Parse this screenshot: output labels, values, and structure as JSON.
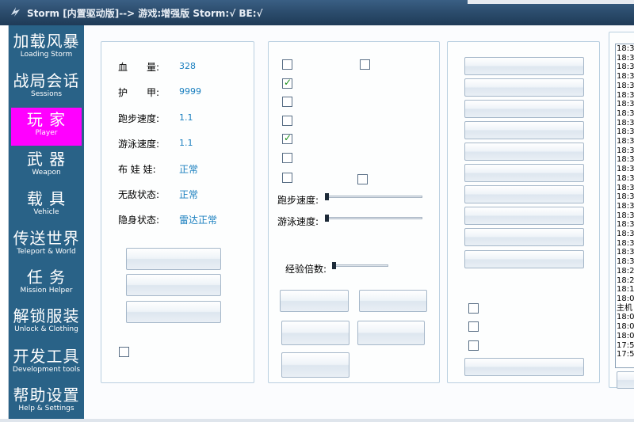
{
  "window": {
    "title": "Storm [内置驱动版]--> 游戏:增强版 Storm:√ BE:√"
  },
  "sidebar": {
    "items": [
      {
        "cn": "加载风暴",
        "en": "Loading Storm"
      },
      {
        "cn": "战局会话",
        "en": "Sessions"
      },
      {
        "cn": "玩 家",
        "en": "Player"
      },
      {
        "cn": "武 器",
        "en": "Weapon"
      },
      {
        "cn": "载 具",
        "en": "Vehicle"
      },
      {
        "cn": "传送世界",
        "en": "Teleport & World"
      },
      {
        "cn": "任 务",
        "en": "Mission Helper"
      },
      {
        "cn": "解锁服装",
        "en": "Unlock & Clothing"
      },
      {
        "cn": "开发工具",
        "en": "Development tools"
      },
      {
        "cn": "帮助设置",
        "en": "Help & Settings"
      }
    ],
    "active_index": 2,
    "active_color": "#ff00ff"
  },
  "player_stats": {
    "health_label": "血　　量:",
    "health_value": "328",
    "armor_label": "护　　甲:",
    "armor_value": "9999",
    "run_speed_label": "跑步速度:",
    "run_speed_value": "1.1",
    "swim_speed_label": "游泳速度:",
    "swim_speed_value": "1.1",
    "ragdoll_label": "布 娃 娃:",
    "ragdoll_value": "正常",
    "invincible_label": "无敌状态:",
    "invincible_value": "正常",
    "stealth_label": "隐身状态:",
    "stealth_value": "雷达正常"
  },
  "player_options": {
    "checkboxes_checked": [
      false,
      false,
      true,
      false,
      false,
      true,
      false,
      false,
      false
    ],
    "run_speed_slider_label": "跑步速度:",
    "run_speed_slider_value": 0,
    "swim_speed_slider_label": "游泳速度:",
    "swim_speed_slider_value": 0,
    "exp_multiplier_label": "经验倍数:",
    "exp_multiplier_value": 0
  },
  "log": {
    "lines": [
      "18:3",
      "18:3",
      "18:3",
      "18:3",
      "18:3",
      "18:3",
      "18:3",
      "18:3",
      "18:3",
      "18:3",
      "18:3",
      "18:3",
      "18:3",
      "18:3",
      "18:3",
      "18:3",
      "18:3",
      "18:3",
      "18:3",
      "18:3",
      "18:3",
      "18:3",
      "18:3",
      "18:3",
      "18:2",
      "18:2",
      "18:1",
      "18:0",
      "主机",
      "18:0",
      "18:0",
      "18:0",
      "17:5",
      "17:5"
    ]
  },
  "colors": {
    "titlebar": "#2c4d6e",
    "sidebar": "#296287",
    "value_text": "#1a7fbf",
    "panel_border": "#b9cfe0"
  }
}
